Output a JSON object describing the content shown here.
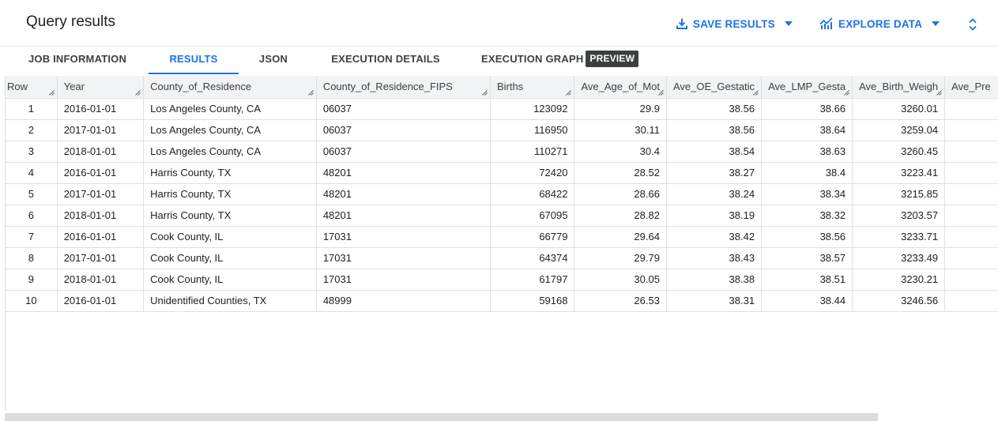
{
  "header": {
    "title": "Query results",
    "save_results": "SAVE RESULTS",
    "explore_data": "EXPLORE DATA"
  },
  "tabs": [
    {
      "label": "JOB INFORMATION"
    },
    {
      "label": "RESULTS"
    },
    {
      "label": "JSON"
    },
    {
      "label": "EXECUTION DETAILS"
    },
    {
      "label": "EXECUTION GRAPH"
    }
  ],
  "preview_badge": "PREVIEW",
  "table": {
    "columns": [
      "Row",
      "Year",
      "County_of_Residence",
      "County_of_Residence_FIPS",
      "Births",
      "Ave_Age_of_Mot",
      "Ave_OE_Gestatic",
      "Ave_LMP_Gesta",
      "Ave_Birth_Weigh",
      "Ave_Pre"
    ],
    "rows": [
      [
        "1",
        "2016-01-01",
        "Los Angeles County, CA",
        "06037",
        "123092",
        "29.9",
        "38.56",
        "38.66",
        "3260.01",
        ""
      ],
      [
        "2",
        "2017-01-01",
        "Los Angeles County, CA",
        "06037",
        "116950",
        "30.11",
        "38.56",
        "38.64",
        "3259.04",
        ""
      ],
      [
        "3",
        "2018-01-01",
        "Los Angeles County, CA",
        "06037",
        "110271",
        "30.4",
        "38.54",
        "38.63",
        "3260.45",
        ""
      ],
      [
        "4",
        "2016-01-01",
        "Harris County, TX",
        "48201",
        "72420",
        "28.52",
        "38.27",
        "38.4",
        "3223.41",
        ""
      ],
      [
        "5",
        "2017-01-01",
        "Harris County, TX",
        "48201",
        "68422",
        "28.66",
        "38.24",
        "38.34",
        "3215.85",
        ""
      ],
      [
        "6",
        "2018-01-01",
        "Harris County, TX",
        "48201",
        "67095",
        "28.82",
        "38.19",
        "38.32",
        "3203.57",
        ""
      ],
      [
        "7",
        "2016-01-01",
        "Cook County, IL",
        "17031",
        "66779",
        "29.64",
        "38.42",
        "38.56",
        "3233.71",
        ""
      ],
      [
        "8",
        "2017-01-01",
        "Cook County, IL",
        "17031",
        "64374",
        "29.79",
        "38.43",
        "38.57",
        "3233.49",
        ""
      ],
      [
        "9",
        "2018-01-01",
        "Cook County, IL",
        "17031",
        "61797",
        "30.05",
        "38.38",
        "38.51",
        "3230.21",
        ""
      ],
      [
        "10",
        "2016-01-01",
        "Unidentified Counties, TX",
        "48999",
        "59168",
        "26.53",
        "38.31",
        "38.44",
        "3246.56",
        ""
      ]
    ]
  },
  "colors": {
    "accent": "#1a73e8",
    "header_bg": "#f1f3f4",
    "badge_bg": "#3c4043"
  },
  "icons": {
    "save": "download-icon",
    "explore": "chart-icon",
    "dropdown": "caret-down-icon",
    "expand": "unfold-icon"
  }
}
